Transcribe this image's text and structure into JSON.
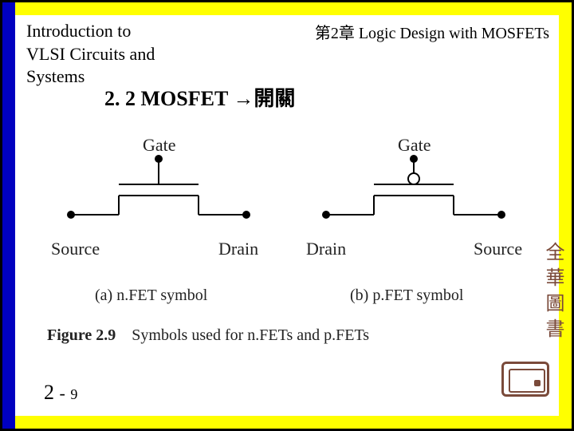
{
  "header": {
    "book_title": "Introduction to\nVLSI Circuits and\nSystems",
    "chapter_right": "第2章 Logic Design with MOSFETs",
    "section_title": "2. 2 MOSFET →開關"
  },
  "figure": {
    "nfet": {
      "gate": "Gate",
      "source": "Source",
      "drain": "Drain",
      "caption": "(a) n.FET symbol"
    },
    "pfet": {
      "gate": "Gate",
      "drain": "Drain",
      "source": "Source",
      "caption": "(b) p.FET symbol"
    },
    "fignum": "Figure 2.9",
    "figtext": "Symbols used for n.FETs and p.FETs"
  },
  "page": {
    "chap": "2",
    "dash": "-",
    "num": "9"
  },
  "side": {
    "publisher_vertical": "全華圖書"
  }
}
